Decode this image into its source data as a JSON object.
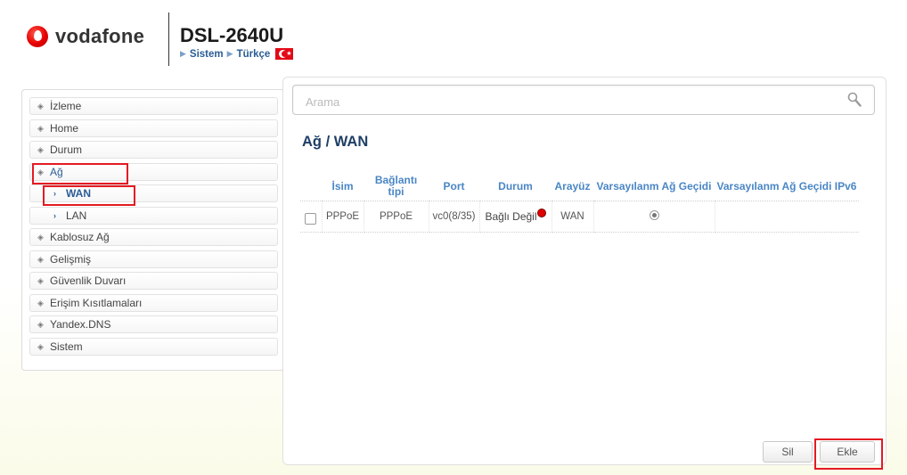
{
  "header": {
    "brand": "vodafone",
    "model": "DSL-2640U",
    "crumb_1": "Sistem",
    "crumb_2": "Türkçe",
    "language_flag": "turkey-flag"
  },
  "sidebar": {
    "items": [
      {
        "label": "İzleme",
        "icon": "diamond-bullet-icon"
      },
      {
        "label": "Home",
        "icon": "diamond-bullet-icon"
      },
      {
        "label": "Durum",
        "icon": "diamond-bullet-icon"
      },
      {
        "label": "Ağ",
        "icon": "diamond-bullet-icon",
        "expanded": true,
        "highlighted": true
      },
      {
        "label": "WAN",
        "icon": "chevron-right-icon",
        "sub": true,
        "selected": true,
        "highlighted": true
      },
      {
        "label": "LAN",
        "icon": "chevron-right-icon",
        "sub": true
      },
      {
        "label": "Kablosuz Ağ",
        "icon": "diamond-bullet-icon"
      },
      {
        "label": "Gelişmiş",
        "icon": "diamond-bullet-icon"
      },
      {
        "label": "Güvenlik Duvarı",
        "icon": "diamond-bullet-icon"
      },
      {
        "label": "Erişim Kısıtlamaları",
        "icon": "diamond-bullet-icon"
      },
      {
        "label": "Yandex.DNS",
        "icon": "diamond-bullet-icon"
      },
      {
        "label": "Sistem",
        "icon": "diamond-bullet-icon"
      }
    ]
  },
  "search": {
    "placeholder": "Arama",
    "value": ""
  },
  "main": {
    "title": "Ağ /  WAN",
    "table": {
      "columns": [
        "İsim",
        "Bağlantı tipi",
        "Port",
        "Durum",
        "Arayüz",
        "Varsayılanm Ağ Geçidi",
        "Varsayılanm Ağ Geçidi IPv6"
      ],
      "rows": [
        {
          "name": "PPPoE",
          "connection_type": "PPPoE",
          "port": "vc0(8/35)",
          "status": "Bağlı Değil",
          "status_color": "#e00000",
          "interface": "WAN",
          "default_gateway": true,
          "default_gateway_ipv6": ""
        }
      ]
    },
    "buttons": {
      "delete_label": "Sil",
      "add_label": "Ekle"
    }
  },
  "colors": {
    "accent_blue": "#2a5d95",
    "header_blue": "#4a86c5",
    "highlight_red": "#e31b23",
    "brand_red": "#e60000"
  }
}
